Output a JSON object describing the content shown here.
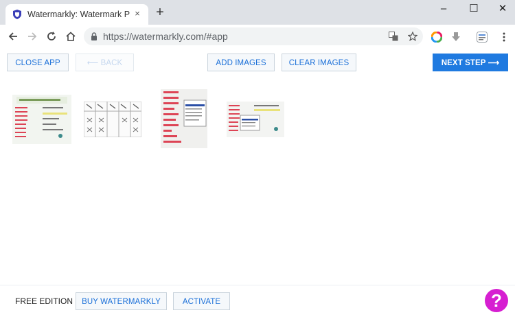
{
  "browser": {
    "tab_title": "Watermarkly: Watermark Photos",
    "tab_close": "×",
    "new_tab": "+",
    "window_controls": [
      "–",
      "☐",
      "✕"
    ],
    "url": "https://watermarkly.com/#app"
  },
  "appbar": {
    "close_app": "CLOSE APP",
    "back": "⟵ BACK",
    "add_images": "ADD IMAGES",
    "clear_images": "CLEAR IMAGES",
    "next_step": "NEXT STEP ⟶"
  },
  "footer": {
    "edition": "FREE EDITION",
    "buy": "BUY WATERMARKLY",
    "activate": "ACTIVATE",
    "help": "?"
  },
  "colors": {
    "primary": "#1f7ae0",
    "help": "#d61fd1"
  }
}
